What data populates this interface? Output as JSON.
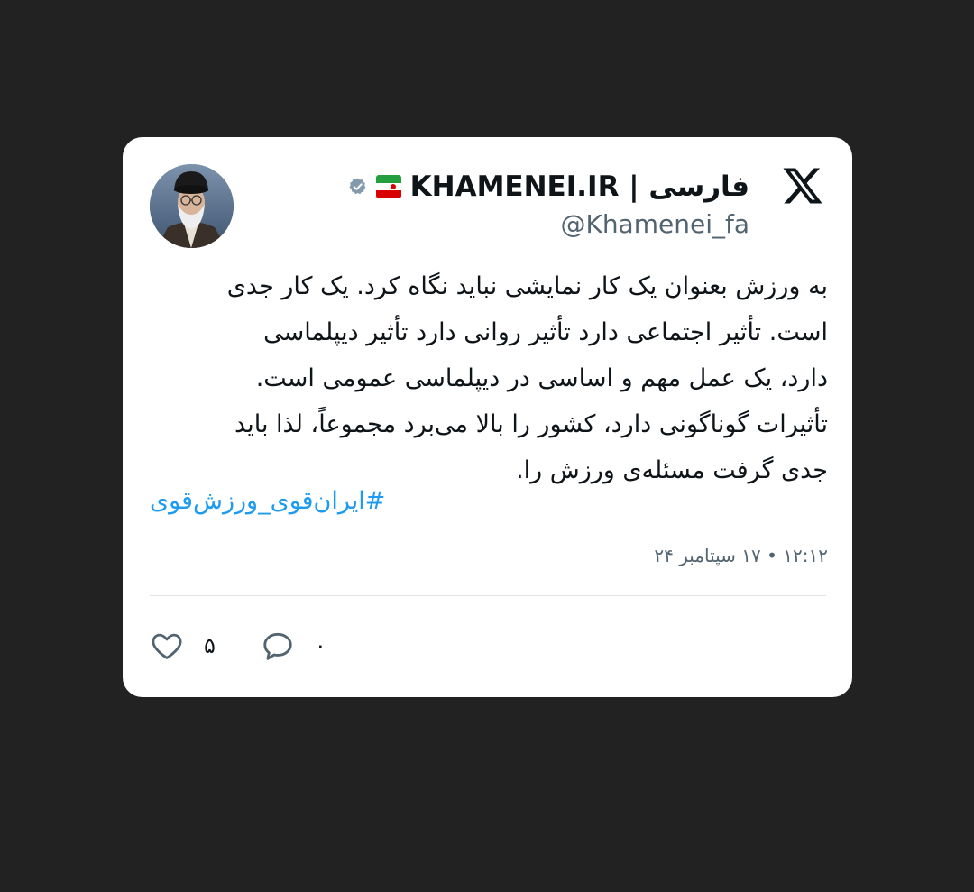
{
  "tweet": {
    "display_name": "KHAMENEI.IR | فارسی",
    "handle": "@Khamenei_fa",
    "platform_logo": "x-logo-icon",
    "verified_icon": "verified-badge-icon",
    "flag_icon": "iran-flag-icon",
    "body": "به ورزش بعنوان یک کار نمایشی نباید نگاه کرد. یک کار جدی\nاست. تأثیر اجتماعی دارد تأثیر روانی دارد تأثیر دیپلماسی\nدارد، یک عمل مهم و اساسی در دیپلماسی عمومی است.\nتأثیرات گوناگونی دارد، کشور را بالا می‌برد مجموعاً، لذا باید\nجدی گرفت مسئله‌ی ورزش را.",
    "hashtag": "#ایران‌قوی_ورزش‌قوی",
    "timestamp": "۱۲:۱۲ • ۱۷ سپتامبر ۲۴",
    "likes_count": "۵",
    "replies_count": "۰"
  },
  "colors": {
    "background": "#222222",
    "card": "#ffffff",
    "text": "#0f1419",
    "muted": "#536471",
    "link": "#1d9bf0",
    "verified": "#829aab"
  }
}
